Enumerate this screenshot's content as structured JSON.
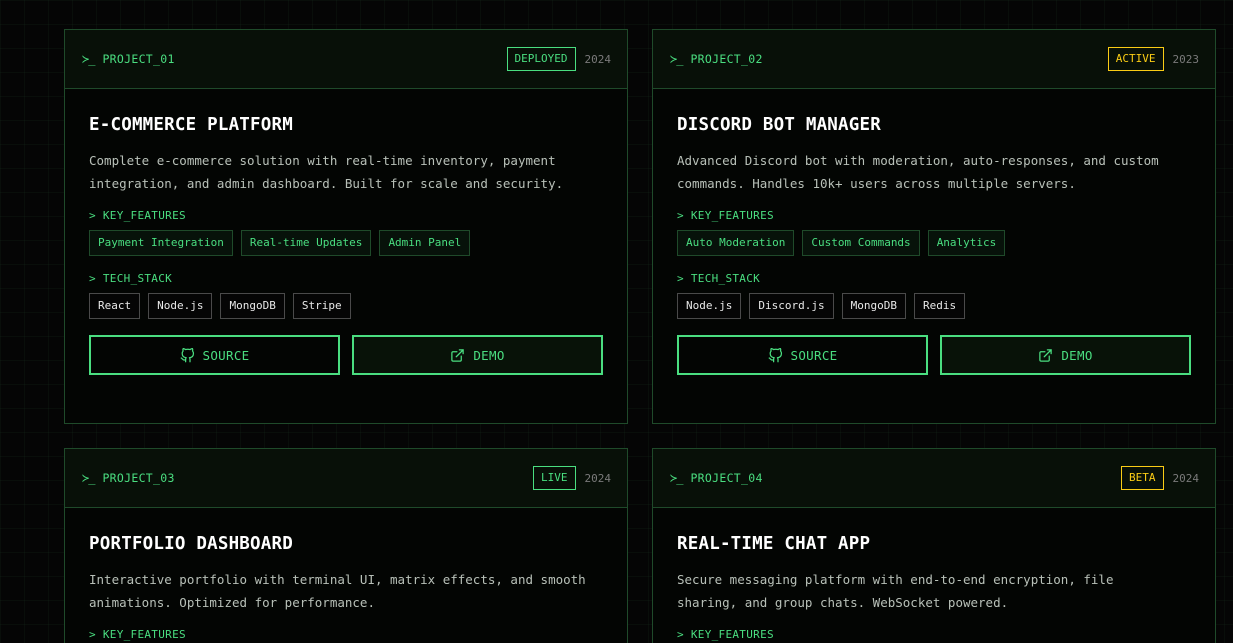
{
  "prompt_symbol": "≻_",
  "cards": [
    {
      "id": "PROJECT_01",
      "status": "DEPLOYED",
      "status_color": "#4ade80",
      "year": "2024",
      "title": "E-COMMERCE PLATFORM",
      "desc_lines": [
        "Complete e-commerce solution with real-time inventory, payment",
        "integration, and admin dashboard. Built for scale and security."
      ],
      "features_label": "> KEY_FEATURES",
      "features": [
        "Payment Integration",
        "Real-time Updates",
        "Admin Panel"
      ],
      "tech_label": "> TECH_STACK",
      "tech": [
        "React",
        "Node.js",
        "MongoDB",
        "Stripe"
      ],
      "source_label": "SOURCE",
      "demo_label": "DEMO"
    },
    {
      "id": "PROJECT_02",
      "status": "ACTIVE",
      "status_color": "#facc15",
      "year": "2023",
      "title": "DISCORD BOT MANAGER",
      "desc_lines": [
        "Advanced Discord bot with moderation, auto-responses, and custom",
        "commands. Handles 10k+ users across multiple servers."
      ],
      "features_label": "> KEY_FEATURES",
      "features": [
        "Auto Moderation",
        "Custom Commands",
        "Analytics"
      ],
      "tech_label": "> TECH_STACK",
      "tech": [
        "Node.js",
        "Discord.js",
        "MongoDB",
        "Redis"
      ],
      "source_label": "SOURCE",
      "demo_label": "DEMO"
    },
    {
      "id": "PROJECT_03",
      "status": "LIVE",
      "status_color": "#4ade80",
      "year": "2024",
      "title": "PORTFOLIO DASHBOARD",
      "desc_lines": [
        "Interactive portfolio with terminal UI, matrix effects, and smooth",
        "animations. Optimized for performance."
      ],
      "features_label": "> KEY_FEATURES"
    },
    {
      "id": "PROJECT_04",
      "status": "BETA",
      "status_color": "#facc15",
      "year": "2024",
      "title": "REAL-TIME CHAT APP",
      "desc_lines": [
        "Secure messaging platform with end-to-end encryption, file",
        "sharing, and group chats. WebSocket powered."
      ],
      "features_label": "> KEY_FEATURES"
    }
  ]
}
